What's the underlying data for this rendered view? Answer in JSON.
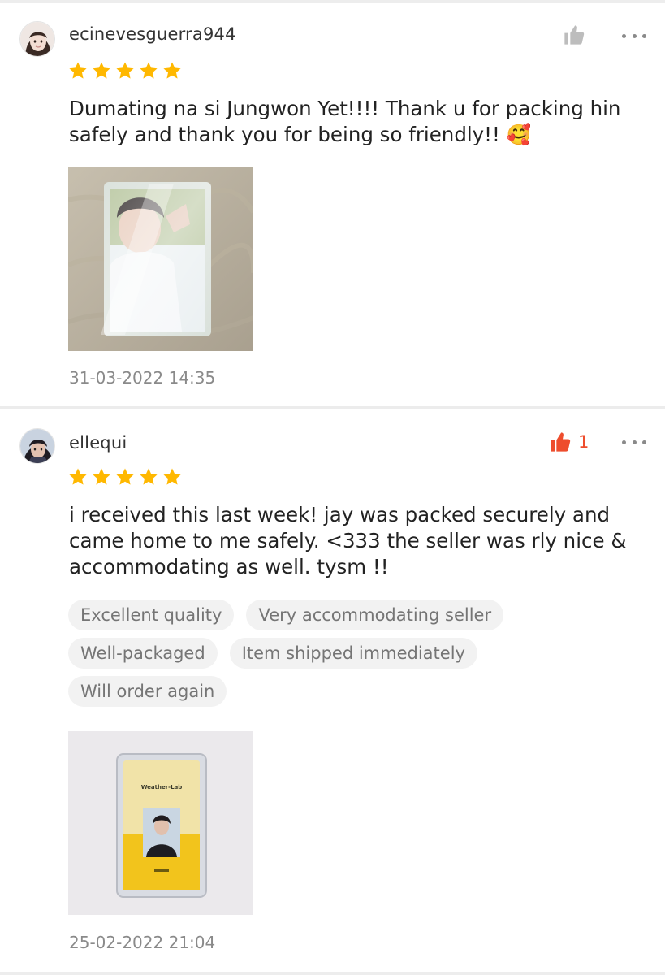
{
  "reviews": [
    {
      "username": "ecinevesguerra944",
      "rating": 5,
      "comment": "Dumating na si Jungwon Yet!!!! Thank u for packing hin safely and thank you for being so friendly!! 🥰",
      "like_count": "",
      "liked": false,
      "timestamp": "31-03-2022 14:35"
    },
    {
      "username": "ellequi",
      "rating": 5,
      "comment": "i received this last week! jay was packed securely and came home to me safely. <333 the seller was rly nice & accommodating as well. tysm !!",
      "like_count": "1",
      "liked": true,
      "tags": [
        "Excellent quality",
        "Very accommodating seller",
        "Well-packaged",
        "Item shipped immediately",
        "Will order again"
      ],
      "photo_card_text": "Weather-Lab",
      "timestamp": "25-02-2022 21:04"
    }
  ],
  "icons": {
    "star": "star-icon",
    "like": "thumbs-up-icon",
    "more": "more-options-icon"
  },
  "colors": {
    "star": "#ffb800",
    "liked": "#ee4d2d",
    "unliked": "#bdbdbd",
    "tag_bg": "#f2f2f2",
    "muted_text": "#8a8a8a"
  }
}
